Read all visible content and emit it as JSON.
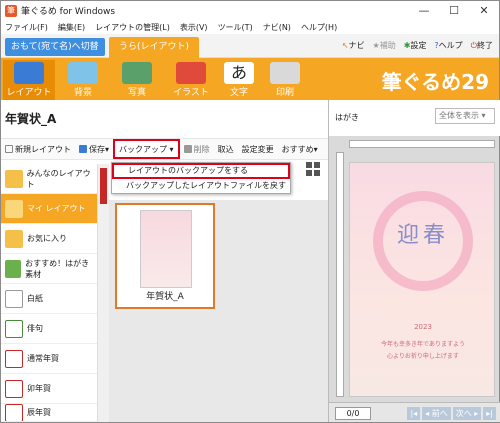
{
  "window": {
    "title": "筆ぐるめ for Windows",
    "controls": [
      "—",
      "☐",
      "✕"
    ]
  },
  "menu": [
    "ファイル(F)",
    "編集(E)",
    "レイアウトの管理(L)",
    "表示(V)",
    "ツール(T)",
    "ナビ(N)",
    "ヘルプ(H)"
  ],
  "tabs": {
    "switch_label": "おもて(宛て名)へ切替",
    "layout_label": "うら(レイアウト)"
  },
  "topright": {
    "navi": "ナビ",
    "hojo": "補助",
    "settings": "設定",
    "help": "ヘルプ",
    "exit": "終了"
  },
  "ribbon": {
    "buttons": [
      "レイアウト",
      "背景",
      "写真",
      "イラスト",
      "文字",
      "印刷"
    ],
    "brand": "筆ぐるめ29"
  },
  "doc": {
    "title": "年賀状_A"
  },
  "toolbar": {
    "new_layout": "新規レイアウト",
    "save": "保存",
    "backup": "バックアップ",
    "delete": "削除",
    "import": "取込",
    "settings_change": "設定変更",
    "recommend": "おすすめ"
  },
  "dropdown": {
    "items": [
      "レイアウトのバックアップをする",
      "バックアップしたレイアウトファイルを戻す"
    ]
  },
  "categories": [
    "みんなのレイアウト",
    "マイ レイアウト",
    "お気に入り",
    "おすすめ！はがき素材",
    "白紙",
    "俳句",
    "通常年賀",
    "卯年賀",
    "辰年賀"
  ],
  "thumb": {
    "label": "年賀状_A"
  },
  "preview": {
    "label": "はがき",
    "display_select": "全体を表示",
    "greeting": "迎春",
    "year": "2023",
    "line1": "今年も幸多き年でありますよう",
    "line2": "心よりお祈り申し上げます"
  },
  "footer": {
    "page": "0/0",
    "prev": "◂ 前へ",
    "next": "次へ ▸"
  },
  "colors": {
    "accent": "#f5a623",
    "highlight": "#e0001b",
    "switch": "#3f8fe0"
  }
}
